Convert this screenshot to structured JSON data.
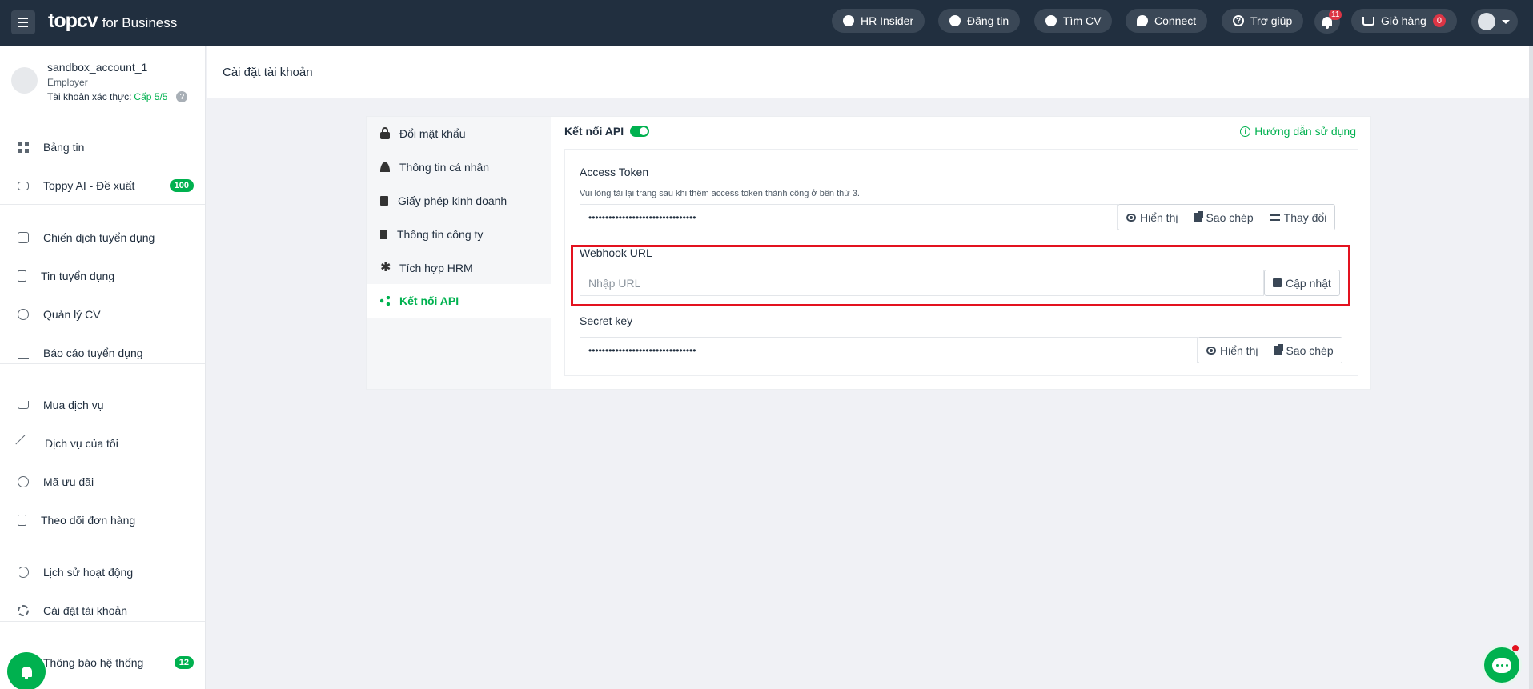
{
  "topbar": {
    "brand": "topcv",
    "brand_suffix": "for Business",
    "nav": {
      "hr_insider": "HR Insider",
      "post_job": "Đăng tin",
      "find_cv": "Tìm CV",
      "connect": "Connect",
      "help": "Trợ giúp",
      "cart": "Giỏ hàng"
    },
    "notification_count": "11",
    "cart_count": "0"
  },
  "profile": {
    "name": "sandbox_account_1",
    "role": "Employer",
    "verify_label": "Tài khoản xác thực:",
    "verify_level": "Cấp 5/5"
  },
  "sidebar": {
    "dashboard": "Bảng tin",
    "toppy_ai": "Toppy AI - Đề xuất",
    "toppy_ai_count": "100",
    "campaigns": "Chiến dịch tuyển dụng",
    "job_posts": "Tin tuyển dụng",
    "cv_manage": "Quản lý CV",
    "reports": "Báo cáo tuyển dụng",
    "buy_services": "Mua dịch vụ",
    "my_services": "Dịch vụ của tôi",
    "coupons": "Mã ưu đãi",
    "orders": "Theo dõi đơn hàng",
    "activity_history": "Lịch sử hoạt động",
    "account_settings": "Cài đặt tài khoản",
    "system_notice": "Thông báo hệ thống",
    "system_notice_count": "12"
  },
  "page": {
    "title": "Cài đặt tài khoản"
  },
  "settings_nav": {
    "change_password": "Đổi mật khẩu",
    "personal_info": "Thông tin cá nhân",
    "business_license": "Giấy phép kinh doanh",
    "company_info": "Thông tin công ty",
    "hrm_integration": "Tích hợp HRM",
    "api_connect": "Kết nối API"
  },
  "api": {
    "heading": "Kết nối API",
    "guide": "Hướng dẫn sử dụng",
    "access_token": {
      "label": "Access Token",
      "hint": "Vui lòng tải lại trang sau khi thêm access token thành công ở bên thứ 3.",
      "masked_value": "••••••••••••••••••••••••••••••••",
      "show": "Hiển thị",
      "copy": "Sao chép",
      "change": "Thay đổi"
    },
    "webhook": {
      "label": "Webhook URL",
      "placeholder": "Nhập URL",
      "update": "Cập nhật"
    },
    "secret_key": {
      "label": "Secret key",
      "masked_value": "••••••••••••••••••••••••••••••••",
      "show": "Hiển thị",
      "copy": "Sao chép"
    }
  },
  "colors": {
    "topbar_bg": "#212f3f",
    "accent_green": "#00b14f",
    "badge_red": "#dc3545",
    "highlight_red": "#e3121f"
  }
}
